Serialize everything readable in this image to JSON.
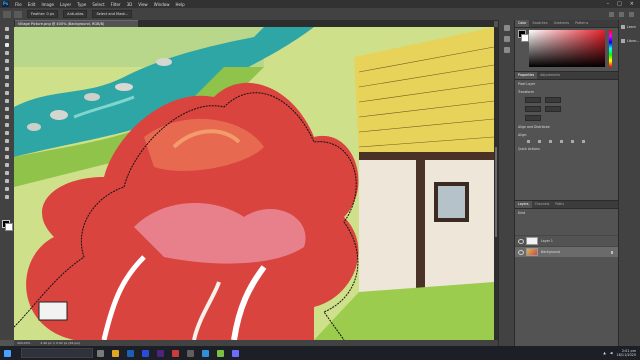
{
  "app": {
    "logo_text": "Ps"
  },
  "menu": [
    "File",
    "Edit",
    "Image",
    "Layer",
    "Type",
    "Select",
    "Filter",
    "3D",
    "View",
    "Window",
    "Help"
  ],
  "options_bar": {
    "feather_label": "Feather: 0 px",
    "antialias_label": "Anti-alias",
    "select_mask_label": "Select and Mask..."
  },
  "document": {
    "tab_title": "Village Picture.png @ 400% (Background, RGB/8)"
  },
  "status_bar": {
    "zoom": "400.00%",
    "doc_info": "2.96 px × 0.92 px (96 ppi)"
  },
  "color_panel": {
    "tabs": [
      "Color",
      "Swatches",
      "Gradients",
      "Patterns"
    ],
    "foreground": "#000000",
    "background": "#ffffff",
    "hue": "#e8202a"
  },
  "properties_panel": {
    "tabs": [
      "Properties",
      "Adjustments"
    ],
    "kind": "Pixel Layer",
    "transform_label": "Transform",
    "align_label": "Align and Distribute",
    "align_sub": "Align:",
    "quick_actions_label": "Quick Actions"
  },
  "layers_panel": {
    "tabs": [
      "Layers",
      "Channels",
      "Paths"
    ],
    "kind_filter": "Kind",
    "layers": [
      {
        "name": "Layer 1",
        "visible": true,
        "selected": false
      },
      {
        "name": "Background",
        "visible": true,
        "selected": true,
        "locked": true
      }
    ]
  },
  "right_dock": {
    "items": [
      "Learn",
      "Librar..."
    ]
  },
  "taskbar": {
    "time": "2:01 pm",
    "date": "16/11/2020"
  }
}
